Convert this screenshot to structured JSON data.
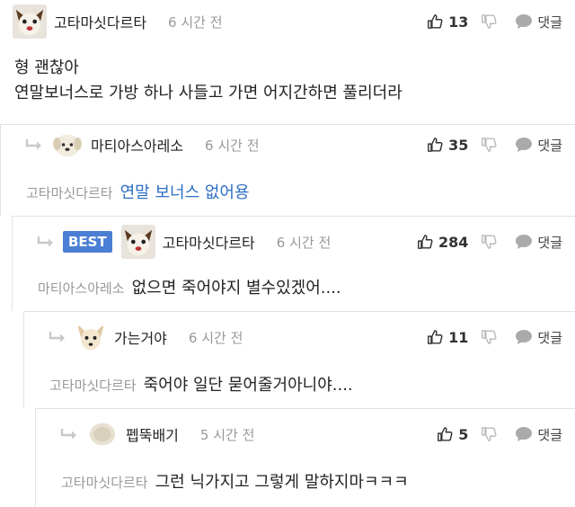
{
  "comments": [
    {
      "author": "고타마싯다르타",
      "time": "6 시간 전",
      "likes": "13",
      "reply_label": "댓글",
      "lines": [
        "형 괜찮아",
        "연말보너스로 가방 하나 사들고 가면 어지간하면 풀리더라"
      ]
    },
    {
      "author": "마티아스아레소",
      "time": "6 시간 전",
      "likes": "35",
      "reply_label": "댓글",
      "mention": "고타마싯다르타",
      "text": "연말 보너스 없어용"
    },
    {
      "badge": "BEST",
      "author": "고타마싯다르타",
      "time": "6 시간 전",
      "likes": "284",
      "reply_label": "댓글",
      "mention": "마티아스아레소",
      "text": "없으면 죽어야지 별수있겠어...."
    },
    {
      "author": "가는거야",
      "time": "6 시간 전",
      "likes": "11",
      "reply_label": "댓글",
      "mention": "고타마싯다르타",
      "text": "죽어야 일단 묻어줄거아니야...."
    },
    {
      "author": "펩뚝배기",
      "time": "5 시간 전",
      "likes": "5",
      "reply_label": "댓글",
      "mention": "고타마싯다르타",
      "text": "그런 닉가지고 그렇게 말하지마ㅋㅋㅋ"
    }
  ],
  "icons": {
    "like": "thumbs-up-icon",
    "dislike": "thumbs-down-icon",
    "reply": "speech-bubble-icon",
    "indent": "reply-arrow-icon"
  },
  "colors": {
    "accent": "#4a7fd4",
    "link": "#2d6fc4",
    "muted": "#999999"
  }
}
